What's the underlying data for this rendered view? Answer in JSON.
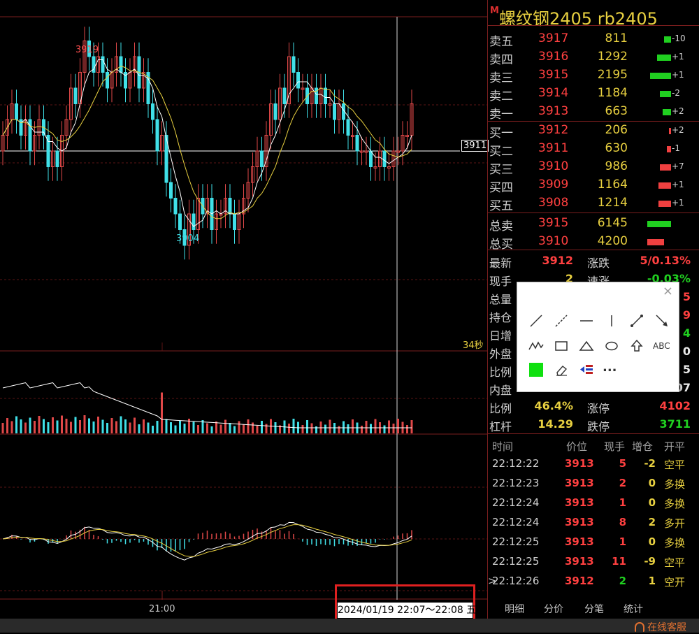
{
  "instrument": {
    "marker": "M",
    "title": "螺纹钢2405  rb2405"
  },
  "chart": {
    "high_label": "3919",
    "low_label": "3904",
    "last_price_tag": "3911",
    "countdown": "34秒",
    "time_axis_label": "21:00",
    "crosshair_time": "2024/01/19 22:07～22:08 五"
  },
  "order_book": {
    "asks": [
      {
        "label": "卖五",
        "price": "3917",
        "volume": "811",
        "change": "-10",
        "bar_color": "#20d020"
      },
      {
        "label": "卖四",
        "price": "3916",
        "volume": "1292",
        "change": "+1",
        "bar_color": "#20d020"
      },
      {
        "label": "卖三",
        "price": "3915",
        "volume": "2195",
        "change": "+1",
        "bar_color": "#20d020"
      },
      {
        "label": "卖二",
        "price": "3914",
        "volume": "1184",
        "change": "-2",
        "bar_color": "#20d020"
      },
      {
        "label": "卖一",
        "price": "3913",
        "volume": "663",
        "change": "+2",
        "bar_color": "#20d020"
      }
    ],
    "bids": [
      {
        "label": "买一",
        "price": "3912",
        "volume": "206",
        "change": "+2",
        "bar_color": "#f04040"
      },
      {
        "label": "买二",
        "price": "3911",
        "volume": "630",
        "change": "-1",
        "bar_color": "#f04040"
      },
      {
        "label": "买三",
        "price": "3910",
        "volume": "986",
        "change": "+7",
        "bar_color": "#f04040"
      },
      {
        "label": "买四",
        "price": "3909",
        "volume": "1164",
        "change": "+1",
        "bar_color": "#f04040"
      },
      {
        "label": "买五",
        "price": "3908",
        "volume": "1214",
        "change": "+1",
        "bar_color": "#f04040"
      }
    ],
    "totals": [
      {
        "label": "总卖",
        "price": "3915",
        "volume": "6145",
        "bar_color": "#20d020"
      },
      {
        "label": "总买",
        "price": "3910",
        "volume": "4200",
        "bar_color": "#f04040"
      }
    ]
  },
  "stats": {
    "left": [
      {
        "label": "最新",
        "value": "3912",
        "color": "#ff4040"
      },
      {
        "label": "现手",
        "value": "2",
        "color": "#e8d040"
      },
      {
        "label": "总量",
        "value": "",
        "color": "#e8d040"
      },
      {
        "label": "持仓",
        "value": "",
        "color": "#e8d040"
      },
      {
        "label": "日增",
        "value": "",
        "color": "#e8d040"
      },
      {
        "label": "外盘",
        "value": "",
        "color": "#ff4040"
      },
      {
        "label": "比例",
        "value": "",
        "color": "#e8d040"
      },
      {
        "label": "内盘",
        "value": "",
        "color": "#20d020"
      },
      {
        "label": "比例",
        "value": "46.4%",
        "color": "#e8d040"
      },
      {
        "label": "杠杆",
        "value": "14.29",
        "color": "#e8d040"
      }
    ],
    "right": [
      {
        "label": "涨跌",
        "value": "5/0.13%",
        "color": "#ff4040"
      },
      {
        "label": "速涨",
        "value": "-0.03%",
        "color": "#20d020"
      },
      {
        "label": "",
        "value": "5",
        "color": "#ff4040"
      },
      {
        "label": "",
        "value": "9",
        "color": "#ff4040"
      },
      {
        "label": "",
        "value": "4",
        "color": "#20d020"
      },
      {
        "label": "",
        "value": "0",
        "color": "#e8e8e8"
      },
      {
        "label": "",
        "value": "5",
        "color": "#e8e8e8"
      },
      {
        "label": "",
        "value": "07",
        "color": "#e8e8e8"
      },
      {
        "label": "涨停",
        "value": "4102",
        "color": "#ff4040"
      },
      {
        "label": "跌停",
        "value": "3711",
        "color": "#20d020"
      }
    ]
  },
  "ticks": {
    "headers": [
      "时间",
      "价位",
      "现手",
      "增仓",
      "开平"
    ],
    "rows": [
      {
        "time": "22:12:22",
        "price": "3913",
        "qty": "5",
        "oi": "-2",
        "type": "空平",
        "qty_color": "#ff4040",
        "oi_color": "#e8d040"
      },
      {
        "time": "22:12:23",
        "price": "3913",
        "qty": "2",
        "oi": "0",
        "type": "多换",
        "qty_color": "#ff4040",
        "oi_color": "#e8d040"
      },
      {
        "time": "22:12:24",
        "price": "3913",
        "qty": "1",
        "oi": "0",
        "type": "多换",
        "qty_color": "#ff4040",
        "oi_color": "#e8d040"
      },
      {
        "time": "22:12:24",
        "price": "3913",
        "qty": "8",
        "oi": "2",
        "type": "多开",
        "qty_color": "#ff4040",
        "oi_color": "#e8d040"
      },
      {
        "time": "22:12:25",
        "price": "3913",
        "qty": "1",
        "oi": "0",
        "type": "多换",
        "qty_color": "#ff4040",
        "oi_color": "#e8d040"
      },
      {
        "time": "22:12:25",
        "price": "3913",
        "qty": "11",
        "oi": "-9",
        "type": "空平",
        "qty_color": "#ff4040",
        "oi_color": "#e8d040"
      },
      {
        "time": "22:12:26",
        "price": "3912",
        "qty": "2",
        "oi": "1",
        "type": "空开",
        "qty_color": "#20d020",
        "oi_color": "#e8d040"
      }
    ],
    "current_marker": ">"
  },
  "tabs": [
    "明细",
    "分价",
    "分笔",
    "统计"
  ],
  "toolbox": {
    "close_label": "×",
    "text_tool_label": "ABC",
    "more_label": "...",
    "color_swatch": "#10e010"
  },
  "footer": {
    "service_label": "在线客服"
  }
}
